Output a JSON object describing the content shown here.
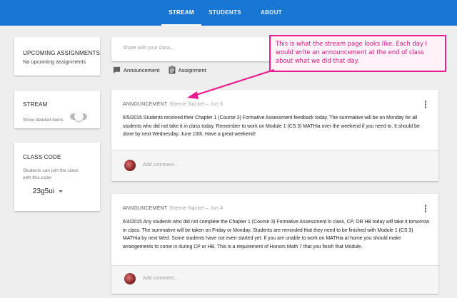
{
  "tabs": [
    {
      "label": "STREAM",
      "active": true
    },
    {
      "label": "STUDENTS",
      "active": false
    },
    {
      "label": "ABOUT",
      "active": false
    }
  ],
  "sidebar": {
    "upcoming": {
      "title": "UPCOMING ASSIGNMENTS",
      "text": "No upcoming assignments"
    },
    "stream": {
      "title": "STREAM",
      "toggle_label": "Show deleted items",
      "toggle_on": false
    },
    "class_code": {
      "title": "CLASS CODE",
      "description": "Students can join the class with this code:",
      "code": "23g5ui"
    }
  },
  "composer": {
    "placeholder": "Share with your class...",
    "actions": [
      {
        "label": "Announcement",
        "icon": "announcement-icon"
      },
      {
        "label": "Assignment",
        "icon": "assignment-icon"
      }
    ]
  },
  "callout": {
    "text": "This is what the stream page looks like. Each day I would write an announcement at the end of class about what we did that day."
  },
  "posts": [
    {
      "type": "ANNOUNCEMENT",
      "author": "Sherrie Nackel – Jun 5",
      "body": "6/5/2015 Students received their Chapter 1 (Course 3) Formative Assessment feedback today. The summative will be on Monday for all students who did not take it in class today. Remember to work on Module 1 (CS 3) MATHia over the weekend if you need to. It should be done by next Wednesday, June 10th. Have a great weekend!",
      "comment_placeholder": "Add comment..."
    },
    {
      "type": "ANNOUNCEMENT",
      "author": "Sherrie Nackel – Jun 4",
      "body": "6/4/2015 Any students who did not complete the Chapter 1 (Course 3) Formative Assessment in class, CP, OR HB today will take it tomorrow in class. The summative will be taken on Friday or Monday. Students are reminded that they need to be finished with Module 1 (CS 3) MATHia by next Wed. Some students have not even started yet. If you are unable to work on MATHia at home you should make arrangements to come in during CP or HB. This is a requirement of Honors Math 7 that you finish that Module.",
      "comment_placeholder": "Add comment..."
    }
  ],
  "colors": {
    "header": "#1976d2",
    "callout": "#e91e8c",
    "background": "#eeeeee"
  }
}
